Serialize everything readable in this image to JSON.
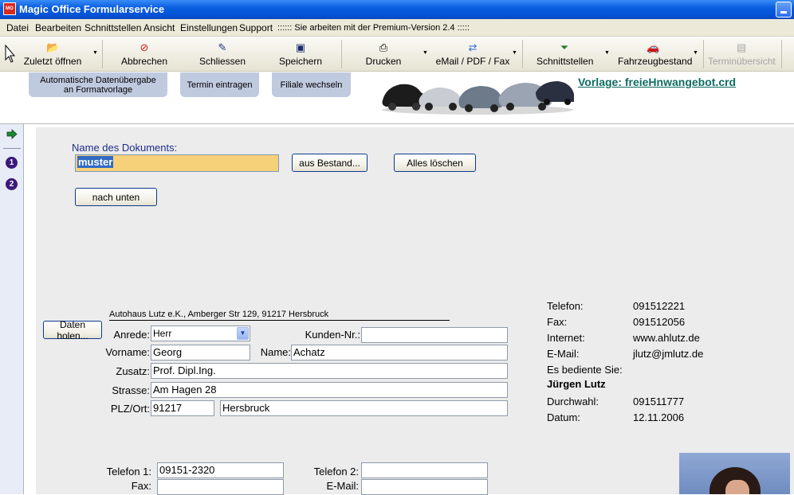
{
  "window": {
    "title": "Magic Office Formularservice",
    "icon_text": "MO"
  },
  "menu": {
    "items": [
      "Datei",
      "Bearbeiten",
      "Schnittstellen",
      "Ansicht",
      "Einstellungen",
      "Support"
    ],
    "notice": ":::::: Sie arbeiten mit der Premium-Version 2.4 :::::"
  },
  "toolbar": {
    "zuletzt": "Zuletzt öffnen",
    "abbrechen": "Abbrechen",
    "schliessen": "Schliessen",
    "speichern": "Speichern",
    "drucken": "Drucken",
    "email": "eMail / PDF / Fax",
    "schnittstellen": "Schnittstellen",
    "fahrzeugbestand": "Fahrzeugbestand",
    "terminuebersicht": "Terminübersicht"
  },
  "header": {
    "auto_daten_line1": "Automatische Datenübergabe",
    "auto_daten_line2": "an Formatvorlage",
    "termin": "Termin eintragen",
    "filiale": "Filiale wechseln",
    "vorlage": "Vorlage: freieHnwangebot.crd"
  },
  "sidebar": {
    "step1": "1",
    "step2": "2"
  },
  "form": {
    "doc_name_label": "Name des Dokuments:",
    "doc_name_value": "muster",
    "aus_bestand": "aus Bestand...",
    "alles_loeschen": "Alles löschen",
    "nach_unten": "nach unten",
    "letterhead": "Autohaus Lutz e.K., Amberger Str 129, 91217 Hersbruck",
    "daten_holen": "Daten holen...",
    "anrede_label": "Anrede:",
    "anrede_value": "Herr",
    "kunden_nr_label": "Kunden-Nr.:",
    "kunden_nr_value": "",
    "vorname_label": "Vorname:",
    "vorname_value": "Georg",
    "name_label": "Name:",
    "name_value": "Achatz",
    "zusatz_label": "Zusatz:",
    "zusatz_value": "Prof. Dipl.Ing.",
    "strasse_label": "Strasse:",
    "strasse_value": "Am Hagen 28",
    "plz_ort_label": "PLZ/Ort:",
    "plz_value": "91217",
    "ort_value": "Hersbruck",
    "telefon1_label": "Telefon 1:",
    "telefon1_value": "09151-2320",
    "telefon2_label": "Telefon 2:",
    "telefon2_value": "",
    "fax_label": "Fax:",
    "fax_value": "",
    "email_label": "E-Mail:",
    "email_value": ""
  },
  "info": {
    "telefon_label": "Telefon:",
    "telefon_value": "091512221",
    "fax_label": "Fax:",
    "fax_value": "091512056",
    "internet_label": "Internet:",
    "internet_value": "www.ahlutz.de",
    "email_label": "E-Mail:",
    "email_value": "jlutz@jmlutz.de",
    "bediente_label": "Es bediente Sie:",
    "bediente_name": "Jürgen Lutz",
    "durchwahl_label": "Durchwahl:",
    "durchwahl_value": "091511777",
    "datum_label": "Datum:",
    "datum_value": "12.11.2006"
  },
  "colors": {
    "titlebar": "#0a5ee0",
    "link": "#0d6c60",
    "highlight_field": "#f7d07a",
    "selection": "#316ac5"
  }
}
